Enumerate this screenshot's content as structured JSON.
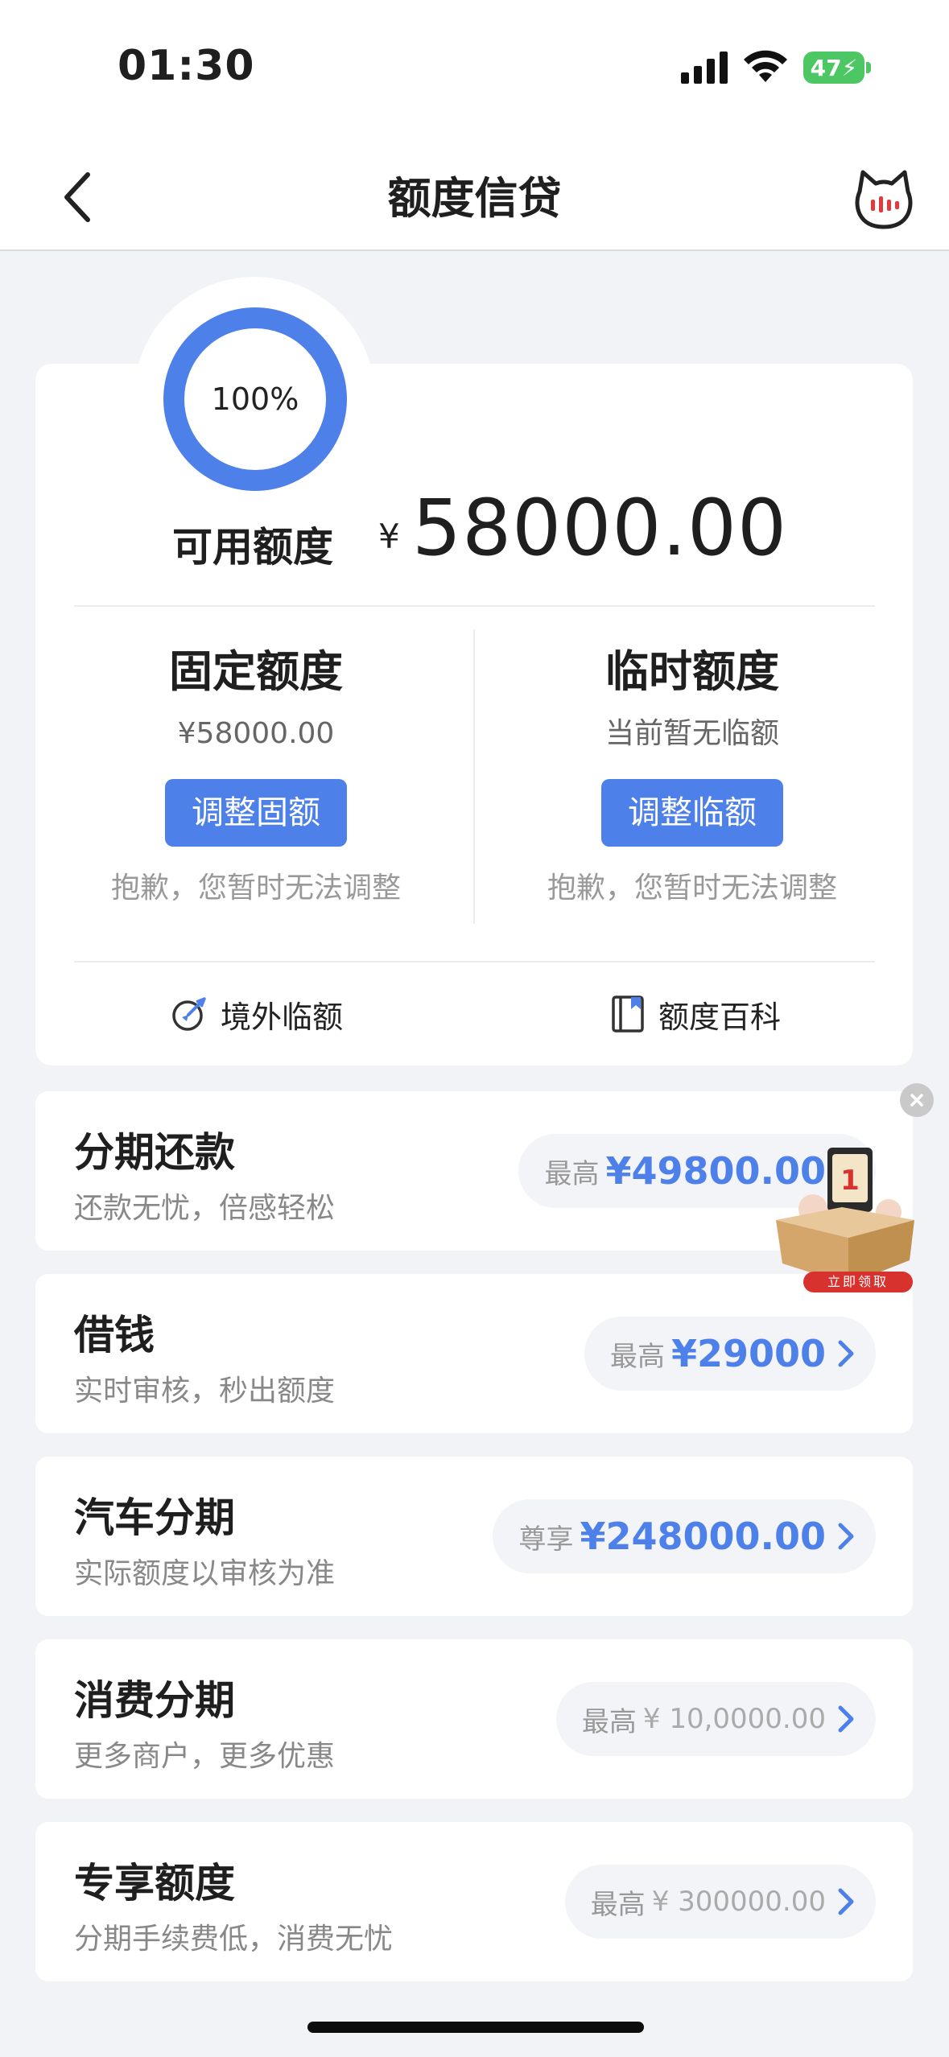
{
  "status_bar": {
    "time": "01:30",
    "battery": "47"
  },
  "nav": {
    "title": "额度信贷"
  },
  "summary": {
    "ring_percent": "100%",
    "available_label": "可用额度",
    "currency": "¥",
    "available_amount": "58000.00",
    "fixed": {
      "title": "固定额度",
      "value": "¥58000.00",
      "button": "调整固额",
      "note": "抱歉，您暂时无法调整"
    },
    "temporary": {
      "title": "临时额度",
      "value": "当前暂无临额",
      "button": "调整临额",
      "note": "抱歉，您暂时无法调整"
    },
    "links": [
      {
        "label": "境外临额",
        "icon": "plane-clock-icon"
      },
      {
        "label": "额度百科",
        "icon": "book-icon"
      }
    ]
  },
  "products": [
    {
      "title": "分期还款",
      "subtitle": "还款无忧，倍感轻松",
      "prefix": "最高",
      "amount": "¥49800.00",
      "highlight": true
    },
    {
      "title": "借钱",
      "subtitle": "实时审核，秒出额度",
      "prefix": "最高",
      "amount": "¥29000",
      "highlight": true
    },
    {
      "title": "汽车分期",
      "subtitle": "实际额度以审核为准",
      "prefix": "尊享",
      "amount": "¥248000.00",
      "highlight": true
    },
    {
      "title": "消费分期",
      "subtitle": "更多商户，更多优惠",
      "prefix": "最高",
      "amount": "¥ 10,0000.00",
      "highlight": false
    },
    {
      "title": "专享额度",
      "subtitle": "分期手续费低，消费无忧",
      "prefix": "最高",
      "amount": "¥ 300000.00",
      "highlight": false
    }
  ],
  "promo": {
    "label": "立即领取",
    "calendar_number": "1"
  },
  "colors": {
    "accent": "#4e80ea",
    "battery": "#4cc763",
    "background": "#f2f3f7"
  }
}
